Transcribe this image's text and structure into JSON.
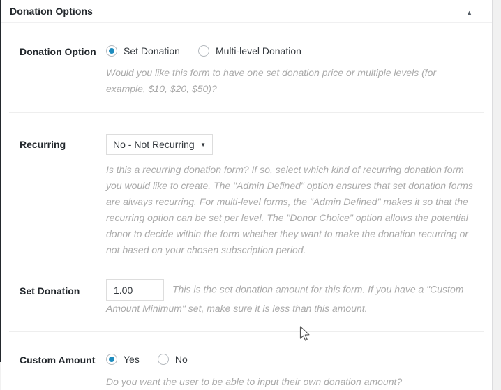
{
  "panel": {
    "title": "Donation Options"
  },
  "icons": {
    "collapse_arrow": "▲",
    "select_arrow": "▼",
    "cursor": "arrow-pointer"
  },
  "colors": {
    "page_bg": "#f1f1f1",
    "panel_bg": "#ffffff",
    "admin_edge": "#23282d",
    "label_text": "#23282d",
    "description_text": "#aaaaaa",
    "field_border": "#dddddd",
    "radio_accent": "#1e8cbe"
  },
  "sections": [
    {
      "label": "Donation Option",
      "control": "radio-group",
      "options": [
        {
          "label": "Set Donation",
          "selected": true
        },
        {
          "label": "Multi-level Donation",
          "selected": false
        }
      ],
      "description": "Would you like this form to have one set donation price or multiple levels (for example, $10, $20, $50)?"
    },
    {
      "label": "Recurring",
      "control": "select",
      "value": "No - Not Recurring",
      "description": "Is this a recurring donation form? If so, select which kind of recurring donation form you would like to create. The \"Admin Defined\" option ensures that set donation forms are always recurring. For multi-level forms, the \"Admin Defined\" makes it so that the recurring option can be set per level. The \"Donor Choice\" option allows the potential donor to decide within the form whether they want to make the donation recurring or not based on your chosen subscription period."
    },
    {
      "label": "Set Donation",
      "control": "text-input",
      "value": "1.00",
      "description": "This is the set donation amount for this form. If you have a \"Custom Amount Minimum\" set, make sure it is less than this amount."
    },
    {
      "label": "Custom Amount",
      "control": "radio-group",
      "options": [
        {
          "label": "Yes",
          "selected": true
        },
        {
          "label": "No",
          "selected": false
        }
      ],
      "description": "Do you want the user to be able to input their own donation amount?"
    }
  ]
}
